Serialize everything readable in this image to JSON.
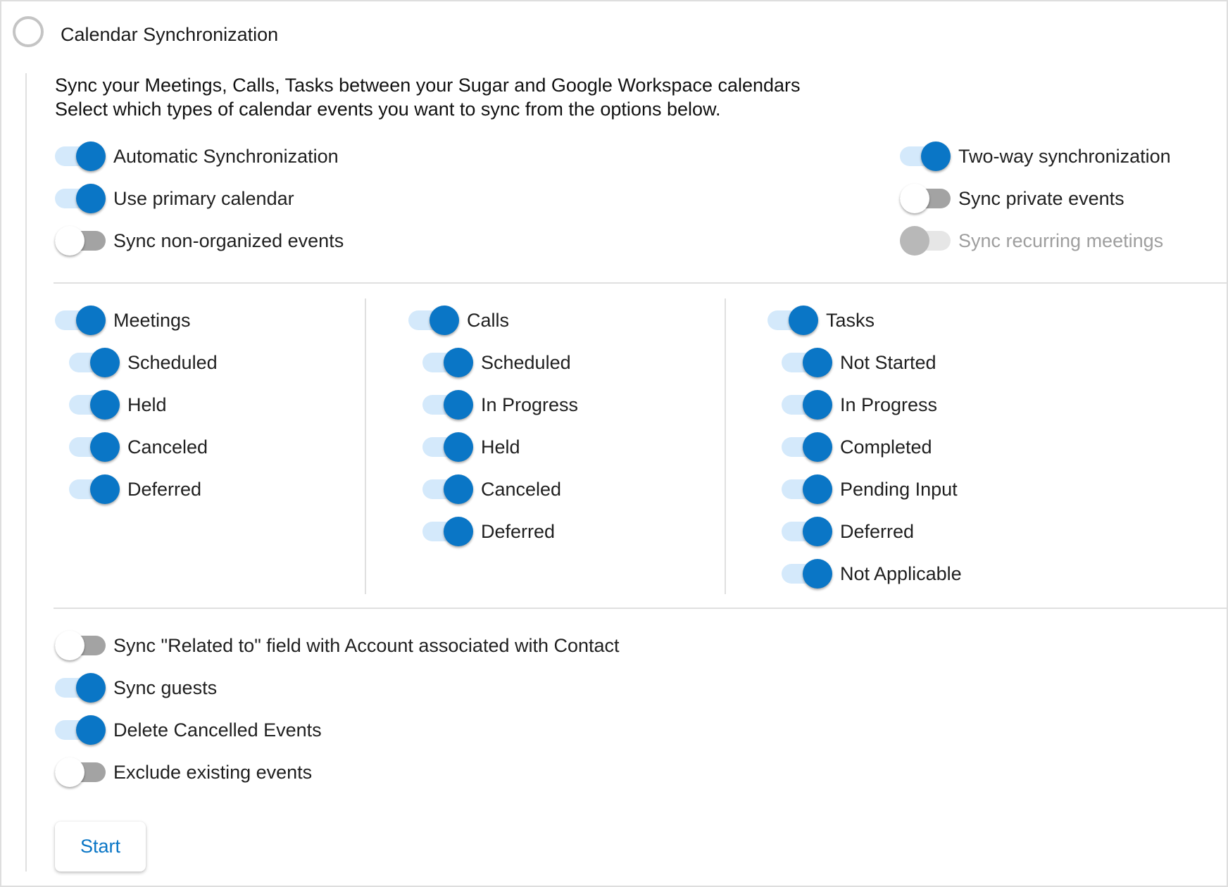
{
  "header": {
    "title": "Calendar Synchronization",
    "step_icon": "empty-circle-icon"
  },
  "description": {
    "line1": "Sync your Meetings, Calls, Tasks between your Sugar and Google Workspace calendars",
    "line2": "Select which types of calendar events you want to sync from the options below."
  },
  "general_left": [
    {
      "label": "Automatic Synchronization",
      "state": "on"
    },
    {
      "label": "Use primary calendar",
      "state": "on"
    },
    {
      "label": "Sync non-organized events",
      "state": "off"
    }
  ],
  "general_right": [
    {
      "label": "Two-way synchronization",
      "state": "on"
    },
    {
      "label": "Sync private events",
      "state": "off"
    },
    {
      "label": "Sync recurring meetings",
      "state": "disabled"
    }
  ],
  "modules": {
    "meetings": {
      "label": "Meetings",
      "state": "on",
      "statuses": [
        {
          "label": "Scheduled",
          "state": "on"
        },
        {
          "label": "Held",
          "state": "on"
        },
        {
          "label": "Canceled",
          "state": "on"
        },
        {
          "label": "Deferred",
          "state": "on"
        }
      ]
    },
    "calls": {
      "label": "Calls",
      "state": "on",
      "statuses": [
        {
          "label": "Scheduled",
          "state": "on"
        },
        {
          "label": "In Progress",
          "state": "on"
        },
        {
          "label": "Held",
          "state": "on"
        },
        {
          "label": "Canceled",
          "state": "on"
        },
        {
          "label": "Deferred",
          "state": "on"
        }
      ]
    },
    "tasks": {
      "label": "Tasks",
      "state": "on",
      "statuses": [
        {
          "label": "Not Started",
          "state": "on"
        },
        {
          "label": "In Progress",
          "state": "on"
        },
        {
          "label": "Completed",
          "state": "on"
        },
        {
          "label": "Pending Input",
          "state": "on"
        },
        {
          "label": "Deferred",
          "state": "on"
        },
        {
          "label": "Not Applicable",
          "state": "on"
        }
      ]
    }
  },
  "bottom_options": [
    {
      "label": "Sync \"Related to\" field with Account associated with Contact",
      "state": "off"
    },
    {
      "label": "Sync guests",
      "state": "on"
    },
    {
      "label": "Delete Cancelled Events",
      "state": "on"
    },
    {
      "label": "Exclude existing events",
      "state": "off"
    }
  ],
  "actions": {
    "start_label": "Start"
  },
  "colors": {
    "accent": "#0a76c6",
    "track_on": "#d4e9fb",
    "track_off": "#a3a3a3",
    "disabled_text": "#9e9e9e"
  }
}
